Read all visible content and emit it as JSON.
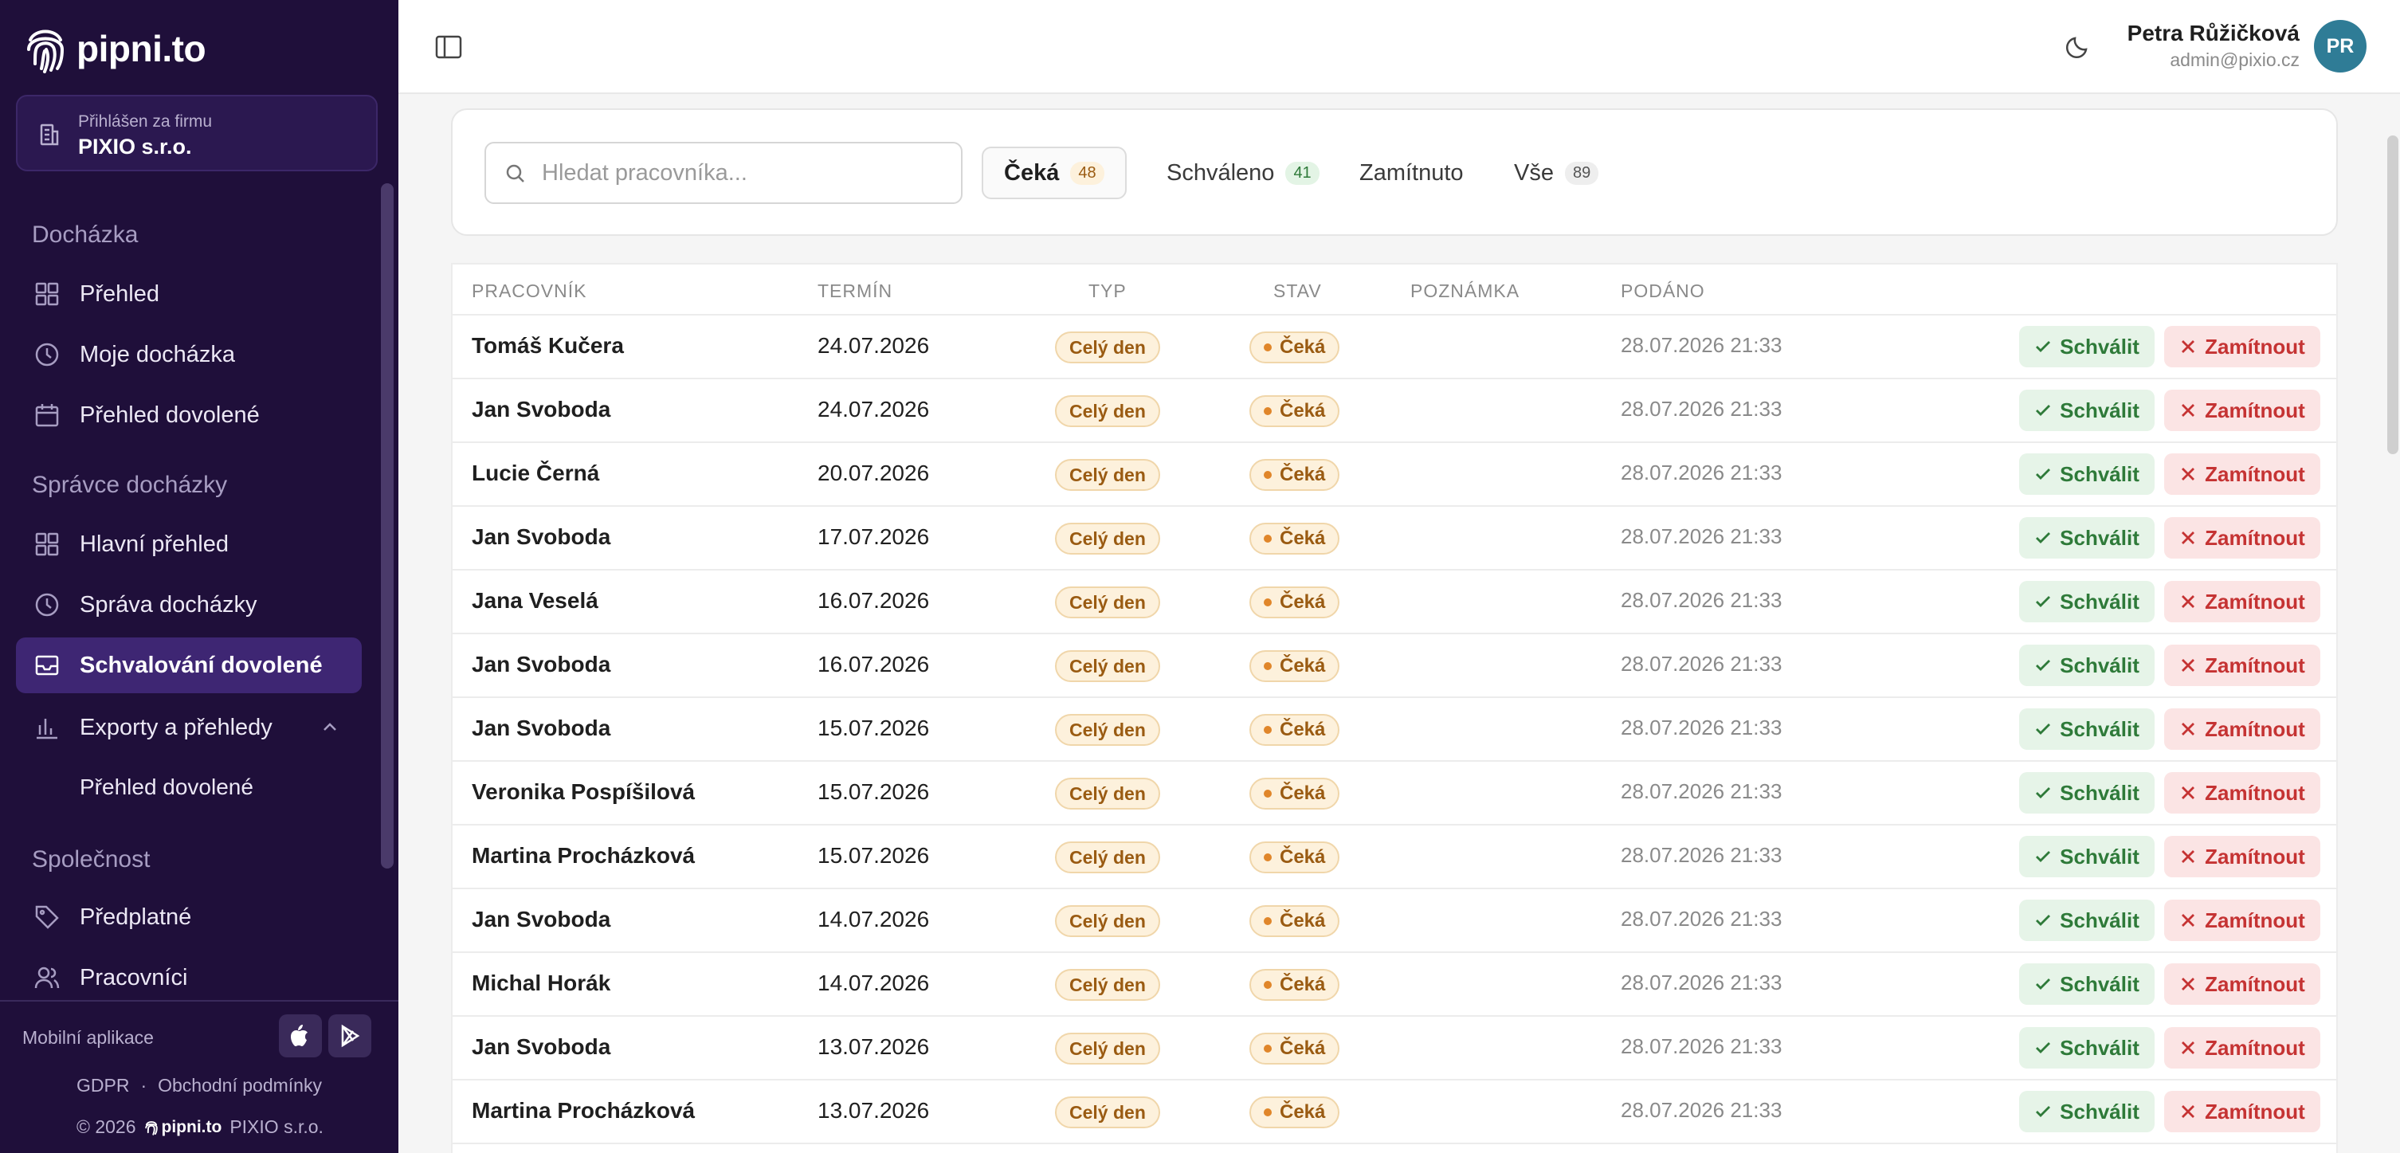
{
  "sidebar": {
    "logo_text": "pipni.to",
    "firm_label": "Přihlášen za firmu",
    "firm_name": "PIXIO s.r.o.",
    "sections": [
      {
        "title": "Docházka",
        "items": [
          {
            "label": "Přehled",
            "icon": "grid-icon"
          },
          {
            "label": "Moje docházka",
            "icon": "clock-icon"
          },
          {
            "label": "Přehled dovolené",
            "icon": "calendar-icon"
          }
        ]
      },
      {
        "title": "Správce docházky",
        "items": [
          {
            "label": "Hlavní přehled",
            "icon": "grid-icon"
          },
          {
            "label": "Správa docházky",
            "icon": "clock-icon"
          },
          {
            "label": "Schvalování dovolené",
            "icon": "inbox-icon",
            "active": true
          },
          {
            "label": "Exporty a přehledy",
            "icon": "bar-chart-icon",
            "expanded": true
          }
        ]
      },
      {
        "title": "Společnost",
        "items": [
          {
            "label": "Předplatné",
            "icon": "tag-icon"
          },
          {
            "label": "Pracovníci",
            "icon": "users-icon"
          }
        ]
      }
    ],
    "sub_item": "Přehled dovolené",
    "footer": {
      "mobile_label": "Mobilní aplikace",
      "gdpr": "GDPR",
      "separator": "·",
      "terms": "Obchodní podmínky",
      "copyright": "© 2026",
      "footer_logo": "pipni.to",
      "company": "PIXIO s.r.o."
    }
  },
  "header": {
    "user_name": "Petra Růžičková",
    "user_email": "admin@pixio.cz",
    "avatar_initials": "PR"
  },
  "filters": {
    "search_placeholder": "Hledat pracovníka...",
    "tabs": [
      {
        "label": "Čeká",
        "count": "48",
        "active": true
      },
      {
        "label": "Schváleno",
        "count": "41"
      },
      {
        "label": "Zamítnuto",
        "count": ""
      },
      {
        "label": "Vše",
        "count": "89"
      }
    ]
  },
  "table": {
    "headers": [
      "PRACOVNÍK",
      "TERMÍN",
      "TYP",
      "STAV",
      "POZNÁMKA",
      "PODÁNO"
    ],
    "approve_label": "Schválit",
    "reject_label": "Zamítnout",
    "rows": [
      {
        "name": "Tomáš Kučera",
        "date": "24.07.2026",
        "type": "Celý den",
        "state": "Čeká",
        "note": "",
        "submitted": "28.07.2026 21:33"
      },
      {
        "name": "Jan Svoboda",
        "date": "24.07.2026",
        "type": "Celý den",
        "state": "Čeká",
        "note": "",
        "submitted": "28.07.2026 21:33"
      },
      {
        "name": "Lucie Černá",
        "date": "20.07.2026",
        "type": "Celý den",
        "state": "Čeká",
        "note": "",
        "submitted": "28.07.2026 21:33"
      },
      {
        "name": "Jan Svoboda",
        "date": "17.07.2026",
        "type": "Celý den",
        "state": "Čeká",
        "note": "",
        "submitted": "28.07.2026 21:33"
      },
      {
        "name": "Jana Veselá",
        "date": "16.07.2026",
        "type": "Celý den",
        "state": "Čeká",
        "note": "",
        "submitted": "28.07.2026 21:33"
      },
      {
        "name": "Jan Svoboda",
        "date": "16.07.2026",
        "type": "Celý den",
        "state": "Čeká",
        "note": "",
        "submitted": "28.07.2026 21:33"
      },
      {
        "name": "Jan Svoboda",
        "date": "15.07.2026",
        "type": "Celý den",
        "state": "Čeká",
        "note": "",
        "submitted": "28.07.2026 21:33"
      },
      {
        "name": "Veronika Pospíšilová",
        "date": "15.07.2026",
        "type": "Celý den",
        "state": "Čeká",
        "note": "",
        "submitted": "28.07.2026 21:33"
      },
      {
        "name": "Martina Procházková",
        "date": "15.07.2026",
        "type": "Celý den",
        "state": "Čeká",
        "note": "",
        "submitted": "28.07.2026 21:33"
      },
      {
        "name": "Jan Svoboda",
        "date": "14.07.2026",
        "type": "Celý den",
        "state": "Čeká",
        "note": "",
        "submitted": "28.07.2026 21:33"
      },
      {
        "name": "Michal Horák",
        "date": "14.07.2026",
        "type": "Celý den",
        "state": "Čeká",
        "note": "",
        "submitted": "28.07.2026 21:33"
      },
      {
        "name": "Jan Svoboda",
        "date": "13.07.2026",
        "type": "Celý den",
        "state": "Čeká",
        "note": "",
        "submitted": "28.07.2026 21:33"
      },
      {
        "name": "Martina Procházková",
        "date": "13.07.2026",
        "type": "Celý den",
        "state": "Čeká",
        "note": "",
        "submitted": "28.07.2026 21:33"
      }
    ]
  },
  "colors": {
    "sidebar_bg": "#1f0f3a",
    "active_item_bg": "#3e2673",
    "approve": "#2e7a39",
    "reject": "#c53333",
    "pending": "#9a5b12",
    "avatar": "#2f7c96"
  }
}
